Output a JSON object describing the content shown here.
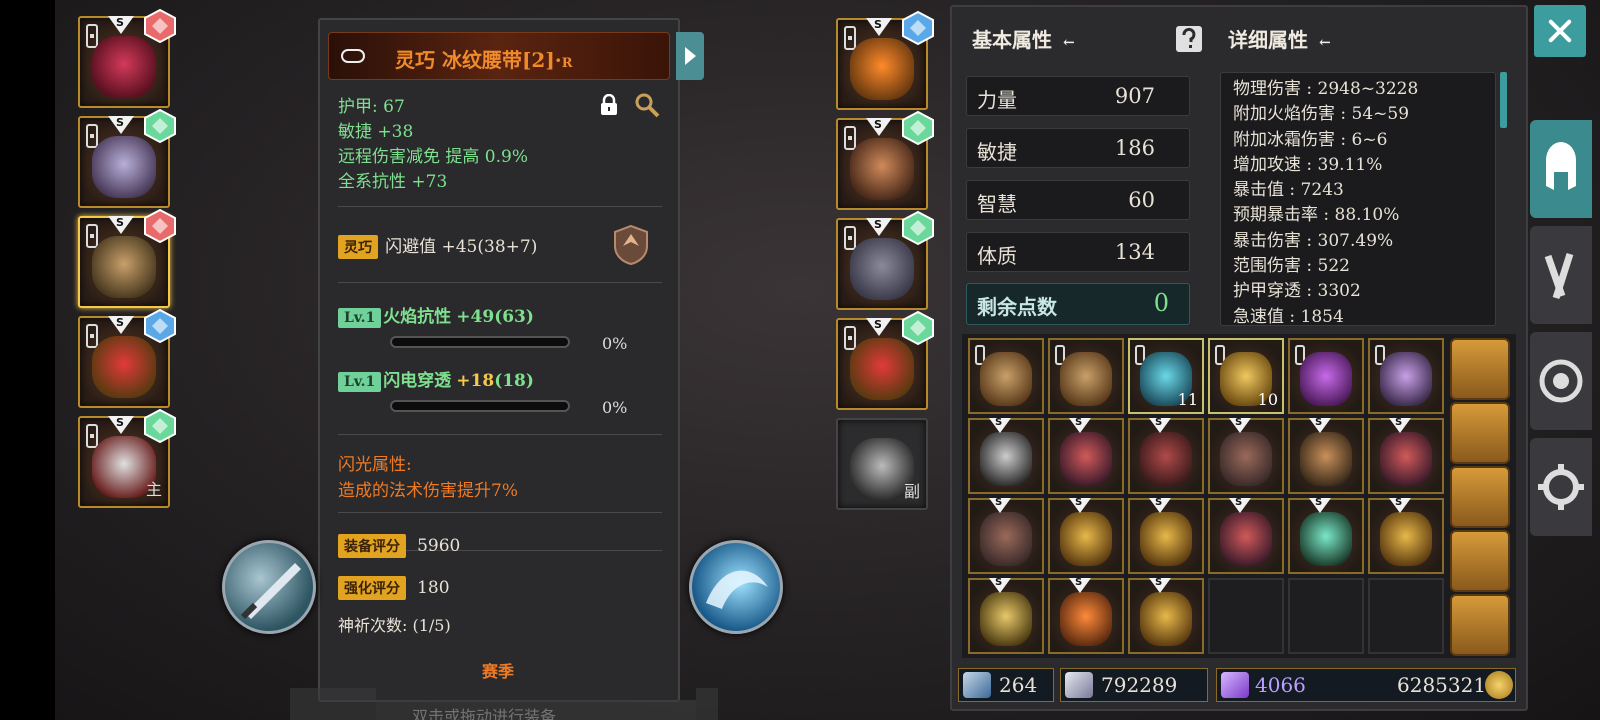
{
  "item": {
    "title": "灵巧 冰纹腰带[2]·",
    "title_suffix": "R",
    "stats": [
      "护甲: 67",
      "敏捷 +38",
      "远程伤害减免 提高 0.9%",
      "全系抗性 +73"
    ],
    "affix_tag": "灵巧",
    "affix_text": "闪避值 +45(38+7)",
    "sockets": [
      {
        "tag": "Lv.1",
        "name": "火焰抗性",
        "bonus": "+49",
        "total": "(63)",
        "progress": "0%"
      },
      {
        "tag": "Lv.1",
        "name": "闪电穿透",
        "bonus": "+18",
        "total": "(18)",
        "progress": "0%"
      }
    ],
    "flash_title": "闪光属性:",
    "flash_text": "造成的法术伤害提升7%",
    "score_label": "装备评分",
    "score_value": "5960",
    "enhance_label": "强化评分",
    "enhance_value": "180",
    "prayer": "神祈次数: (1/5)",
    "season": "赛季",
    "bottom_hint": "双击或拖动进行装备"
  },
  "left_slots": [
    {
      "label": "S",
      "icon": "helmet-icon"
    },
    {
      "label": "S",
      "icon": "armor-icon"
    },
    {
      "label": "S",
      "icon": "belt-icon"
    },
    {
      "label": "S",
      "icon": "ring-icon"
    },
    {
      "label": "S",
      "icon": "sword-icon",
      "sub": "主"
    }
  ],
  "right_slots": [
    {
      "label": "S",
      "icon": "amulet-icon"
    },
    {
      "label": "S",
      "icon": "gloves-icon"
    },
    {
      "label": "S",
      "icon": "pants-icon"
    },
    {
      "label": "S",
      "icon": "ring-icon"
    },
    {
      "label": "",
      "icon": "offhand-sword-icon",
      "sub": "副"
    }
  ],
  "basic": {
    "header": "基本属性",
    "rows": [
      {
        "k": "力量",
        "v": "907"
      },
      {
        "k": "敏捷",
        "v": "186"
      },
      {
        "k": "智慧",
        "v": "60"
      },
      {
        "k": "体质",
        "v": "134"
      }
    ],
    "remaining_label": "剩余点数",
    "remaining_value": "0"
  },
  "detail": {
    "header": "详细属性",
    "lines": [
      "物理伤害 : 2948~3228",
      "附加火焰伤害 : 54~59",
      "附加冰霜伤害 : 6~6",
      "增加攻速 : 39.11%",
      "暴击值 : 7243",
      "预期暴击率 : 88.10%",
      "暴击伤害 : 307.49%",
      "范围伤害 : 522",
      "护甲穿透 : 3302",
      "急速值 : 1854"
    ]
  },
  "inventory": [
    {
      "icon": "pouch-icon",
      "lock": true
    },
    {
      "icon": "pouch-icon",
      "lock": true
    },
    {
      "icon": "crystal-icon",
      "lock": true,
      "count": "11",
      "hl": true
    },
    {
      "icon": "scroll-icon",
      "lock": true,
      "count": "10",
      "hl": true
    },
    {
      "icon": "potion-icon",
      "lock": true
    },
    {
      "icon": "dagger-icon",
      "lock": true
    },
    {
      "icon": "axe-icon",
      "s": true
    },
    {
      "icon": "armor-icon",
      "s": true
    },
    {
      "icon": "chest-icon",
      "s": true
    },
    {
      "icon": "boots-icon",
      "s": true
    },
    {
      "icon": "gloves-icon",
      "s": true
    },
    {
      "icon": "armor-icon",
      "s": true
    },
    {
      "icon": "boots-icon",
      "s": true
    },
    {
      "icon": "ring-icon",
      "s": true
    },
    {
      "icon": "ring-icon",
      "s": true
    },
    {
      "icon": "armor-icon",
      "s": true
    },
    {
      "icon": "bow-icon",
      "s": true
    },
    {
      "icon": "ring-icon",
      "s": true
    },
    {
      "icon": "bracer-icon",
      "s": true
    },
    {
      "icon": "amulet-icon",
      "s": true
    },
    {
      "icon": "ring-icon",
      "s": true
    },
    {
      "icon": "",
      "empty": true
    },
    {
      "icon": "",
      "empty": true
    },
    {
      "icon": "",
      "empty": true
    }
  ],
  "currency": {
    "dust": "264",
    "gems": "792289",
    "crystal": "4066",
    "gold": "6285321"
  },
  "colors": {
    "gold_border": "#b98a2c",
    "teal": "#3c9c9e",
    "stat_green": "#7ee08e",
    "orange": "#f07a22"
  }
}
